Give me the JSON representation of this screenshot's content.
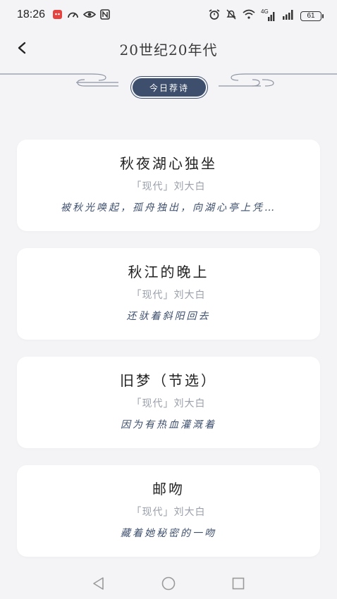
{
  "status": {
    "time": "18:26",
    "network": "4G",
    "battery": "61"
  },
  "header": {
    "title": "20世纪20年代"
  },
  "badge": {
    "label": "今日荐诗"
  },
  "poems": [
    {
      "title": "秋夜湖心独坐",
      "meta": "「现代」刘大白",
      "excerpt": "被秋光唤起，孤舟独出，向湖心亭上凭…"
    },
    {
      "title": "秋江的晚上",
      "meta": "「现代」刘大白",
      "excerpt": "还驮着斜阳回去"
    },
    {
      "title": "旧梦（节选）",
      "meta": "「现代」刘大白",
      "excerpt": "因为有热血灌溉着"
    },
    {
      "title": "邮吻",
      "meta": "「现代」刘大白",
      "excerpt": "藏着她秘密的一吻"
    }
  ],
  "colors": {
    "accent": "#3d4f6d",
    "background": "#f4f4f6",
    "card": "#ffffff",
    "meta": "#9aa0ab"
  },
  "icons": {
    "back": "chevron-left-icon",
    "nav_back": "triangle-back-icon",
    "nav_home": "circle-home-icon",
    "nav_recents": "square-recents-icon"
  }
}
